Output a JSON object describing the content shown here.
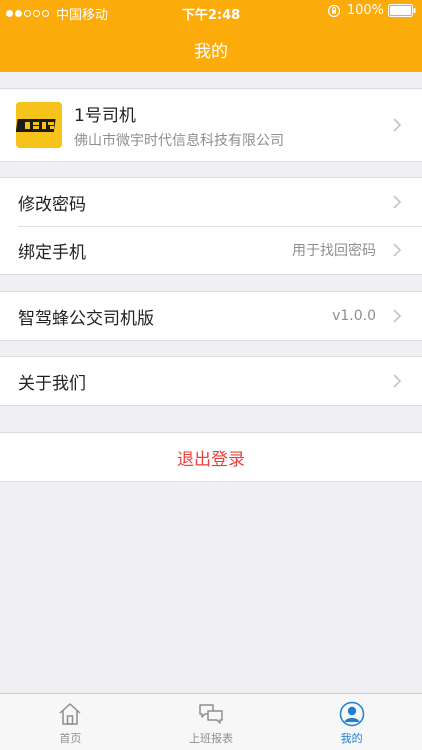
{
  "status_bar": {
    "carrier": "中国移动",
    "time": "下午2:48",
    "battery": "100%"
  },
  "nav": {
    "title": "我的"
  },
  "profile": {
    "name": "1号司机",
    "company": "佛山市微宇时代信息科技有限公司",
    "avatar_icon": "app-logo-icon"
  },
  "account": {
    "change_password": "修改密码",
    "bind_phone": "绑定手机",
    "bind_phone_detail": "用于找回密码"
  },
  "app_info": {
    "name": "智驾蜂公交司机版",
    "version": "v1.0.0"
  },
  "about": {
    "label": "关于我们"
  },
  "logout": {
    "label": "退出登录"
  },
  "tabs": [
    {
      "label": "首页",
      "icon": "home-icon",
      "active": false
    },
    {
      "label": "上班报表",
      "icon": "chat-report-icon",
      "active": false
    },
    {
      "label": "我的",
      "icon": "user-icon",
      "active": true
    }
  ],
  "colors": {
    "header": "#fbab0a",
    "logout": "#e8413b",
    "tab_active": "#1a7fd9",
    "background": "#efeff4"
  }
}
